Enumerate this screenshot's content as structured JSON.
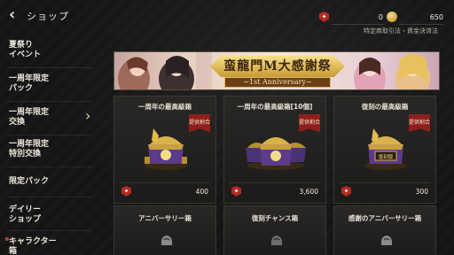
{
  "header": {
    "back_icon": "chevron-left-icon",
    "title": "ショップ",
    "currencies": [
      {
        "icon": "red-gem-icon",
        "value": "0",
        "color": "#b32a23"
      },
      {
        "icon": "gold-coin-icon",
        "value": "650",
        "color": "#d4a640"
      }
    ],
    "legal_link": "特定商取引法・資金決済法"
  },
  "sidebar": {
    "items": [
      {
        "label": "夏祭り\nイベント"
      },
      {
        "label": "一周年限定\nパック"
      },
      {
        "label": "一周年限定\n交換"
      },
      {
        "label": "一周年限定\n特別交換"
      },
      {
        "label": "限定パック"
      },
      {
        "label": "デイリー\nショップ"
      },
      {
        "label": "キャラクター\n箱"
      }
    ],
    "active_index": 2
  },
  "banner": {
    "title": "蛮龍門M大感謝祭",
    "subtitle": "~1st Anniversary~"
  },
  "products": [
    {
      "name": "一周年の最高級箱",
      "badge": "提供割合",
      "price": "400",
      "chest_label": ""
    },
    {
      "name": "一周年の最高級箱[10個]",
      "badge": "提供割合",
      "price": "3,600",
      "chest_label": ""
    },
    {
      "name": "復刻の最高級箱",
      "badge": "提供割合",
      "price": "300",
      "chest_label": "復刻版"
    }
  ],
  "products_row2": [
    {
      "name": "アニバーサリー箱"
    },
    {
      "name": "復刻チャンス箱"
    },
    {
      "name": "感謝のアニバーサリー箱"
    }
  ],
  "colors": {
    "accent_gold": "#d4a640",
    "accent_red": "#8e1f1c"
  }
}
